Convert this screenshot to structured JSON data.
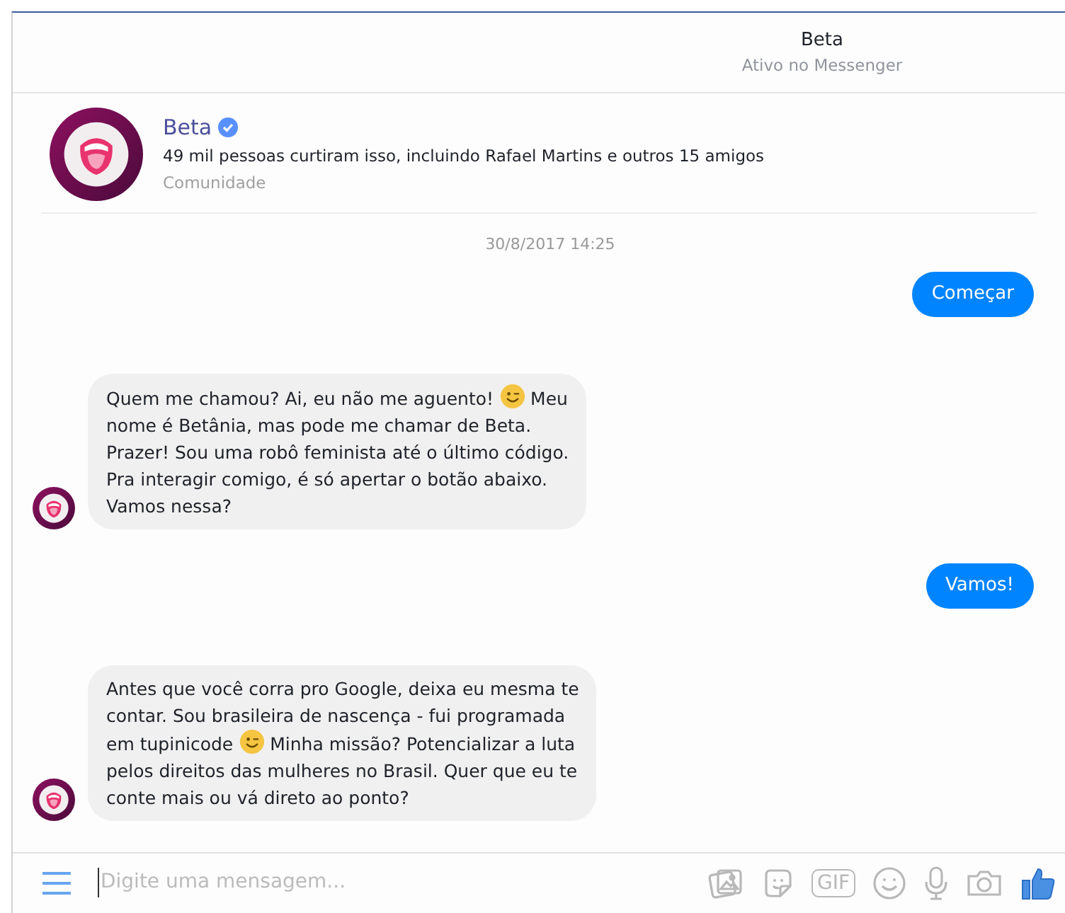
{
  "header": {
    "title": "Beta",
    "status": "Ativo no Messenger"
  },
  "profile": {
    "name": "Beta",
    "verified": true,
    "likes": "49 mil pessoas curtiram isso, incluindo Rafael Martins e outros 15 amigos",
    "category": "Comunidade"
  },
  "timestamp": "30/8/2017 14:25",
  "messages": [
    {
      "kind": "sent",
      "lines": [
        [
          {
            "kind": "text",
            "text": "Começar"
          }
        ]
      ]
    },
    {
      "kind": "received",
      "lines": [
        [
          {
            "kind": "text",
            "text": "Quem me chamou? Ai, eu não me aguento!"
          },
          {
            "kind": "emoji"
          },
          {
            "kind": "text",
            "text": "Meu"
          }
        ],
        [
          {
            "kind": "text",
            "text": "nome é Betânia, mas pode me chamar de Beta."
          }
        ],
        [
          {
            "kind": "text",
            "text": "Prazer! Sou uma robô feminista até o último código."
          }
        ],
        [
          {
            "kind": "text",
            "text": "Pra interagir comigo, é só apertar o botão abaixo."
          }
        ],
        [
          {
            "kind": "text",
            "text": "Vamos nessa?"
          }
        ]
      ]
    },
    {
      "kind": "sent",
      "lines": [
        [
          {
            "kind": "text",
            "text": "Vamos!"
          }
        ]
      ]
    },
    {
      "kind": "received",
      "lines": [
        [
          {
            "kind": "text",
            "text": "Antes que você corra pro Google, deixa eu mesma te"
          }
        ],
        [
          {
            "kind": "text",
            "text": "contar. Sou brasileira de nascença - fui programada"
          }
        ],
        [
          {
            "kind": "text",
            "text": "em tupinicode"
          },
          {
            "kind": "emoji"
          },
          {
            "kind": "text",
            "text": "Minha missão? Potencializar a luta"
          }
        ],
        [
          {
            "kind": "text",
            "text": "pelos direitos das mulheres no Brasil. Quer que eu te"
          }
        ],
        [
          {
            "kind": "text",
            "text": "conte mais ou vá direto ao ponto?"
          }
        ]
      ]
    }
  ],
  "composer": {
    "placeholder": "Digite uma mensagem..."
  },
  "toolbar": [
    {
      "kind": "photo"
    },
    {
      "kind": "sticker"
    },
    {
      "kind": "gif",
      "label": "GIF"
    },
    {
      "kind": "emoji"
    },
    {
      "kind": "mic"
    },
    {
      "kind": "camera"
    },
    {
      "kind": "like"
    }
  ]
}
